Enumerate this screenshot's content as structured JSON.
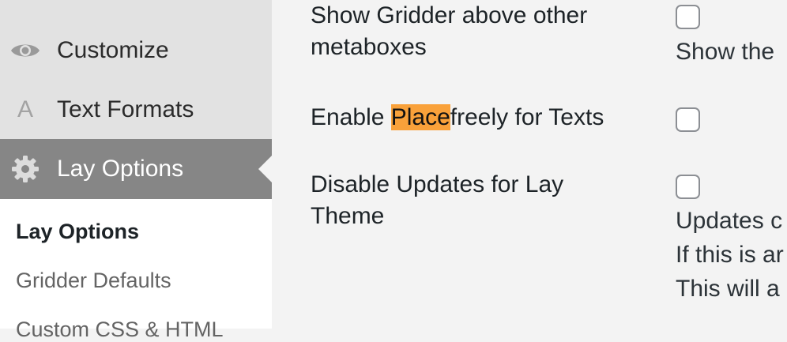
{
  "sidebar": {
    "items": [
      {
        "label": "Customize",
        "icon": "eye-icon"
      },
      {
        "label": "Text Formats",
        "icon": "letter-a-icon",
        "glyph": "A"
      },
      {
        "label": "Lay Options",
        "icon": "gear-icon",
        "active": true
      }
    ],
    "submenu": [
      {
        "label": "Lay Options",
        "current": true
      },
      {
        "label": "Gridder Defaults"
      },
      {
        "label": "Custom CSS & HTML"
      }
    ]
  },
  "options": {
    "gridder_above": {
      "label_line1": "Show Gridder above other",
      "label_line2": "metaboxes",
      "checked": false,
      "description": "Show the"
    },
    "placefreely": {
      "label_prefix": "Enable ",
      "label_highlight": "Place",
      "label_suffix": "freely for Texts",
      "checked": false
    },
    "disable_updates": {
      "label_line1": "Disable Updates for Lay",
      "label_line2": "Theme",
      "checked": false,
      "description_lines": [
        "Updates c",
        "If this is ar",
        "This will a"
      ]
    }
  },
  "colors": {
    "highlight": "#f9a13a",
    "active_menu": "#868686",
    "sidebar": "#e2e2e2"
  }
}
